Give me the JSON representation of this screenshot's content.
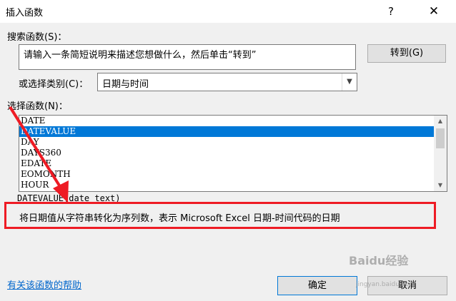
{
  "window": {
    "title": "插入函数",
    "help_glyph": "?",
    "close_glyph": "✕"
  },
  "search": {
    "label": "搜索函数(S)：",
    "value": "请输入一条简短说明来描述您想做什么，然后单击“转到”",
    "go_button": "转到(G)"
  },
  "category": {
    "label": "或选择类别(C)：",
    "selected": "日期与时间"
  },
  "functions": {
    "label": "选择函数(N)：",
    "items": [
      "DATE",
      "DATEVALUE",
      "DAY",
      "DAYS360",
      "EDATE",
      "EOMONTH",
      "HOUR"
    ],
    "selected_index": 1
  },
  "syntax": "DATEVALUE(date_text)",
  "description": "将日期值从字符串转化为序列数，表示 Microsoft Excel 日期-时间代码的日期",
  "footer": {
    "help_link": "有关该函数的帮助",
    "ok_button": "确定",
    "cancel_button": "取消"
  },
  "watermark": {
    "text": "Baidu经验",
    "sub": "jingyan.baidu.com"
  },
  "colors": {
    "accent": "#0078d7",
    "highlight_box": "#ee1b24",
    "link": "#0066cc"
  }
}
